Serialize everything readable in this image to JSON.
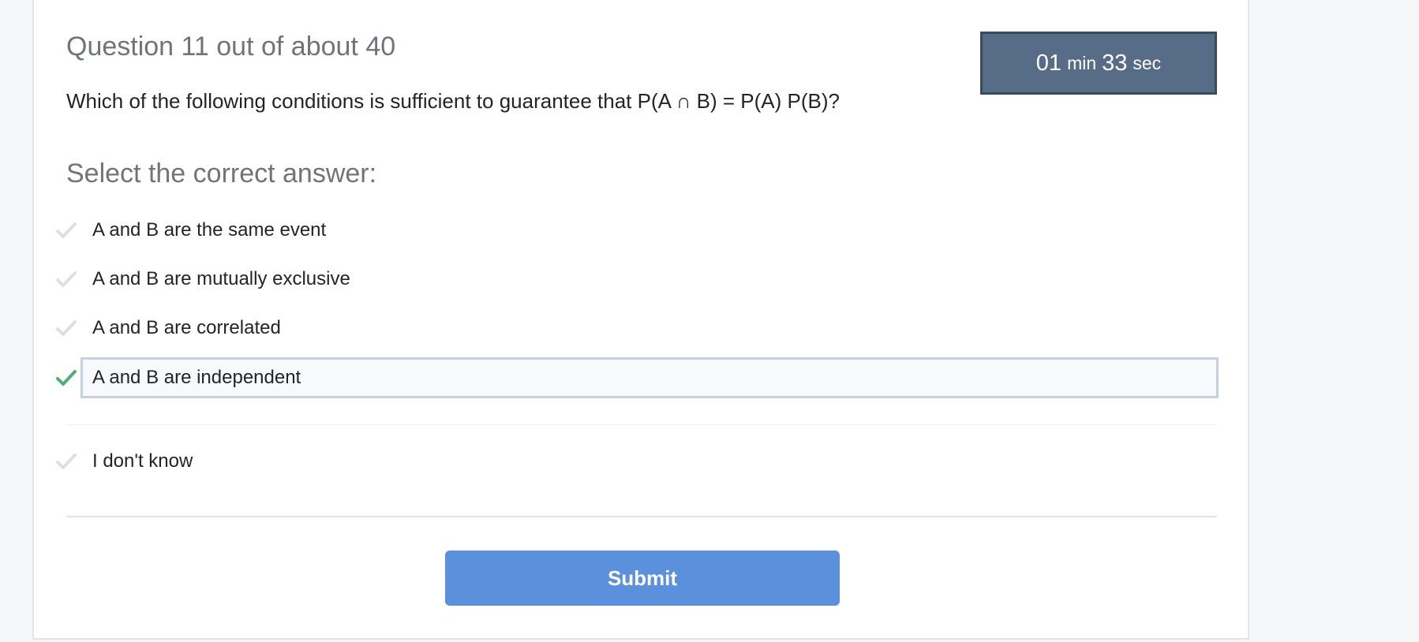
{
  "header": {
    "question_counter": "Question 11 out of about 40"
  },
  "timer": {
    "minutes": "01",
    "minutes_unit": "min",
    "seconds": "33",
    "seconds_unit": "sec"
  },
  "question": {
    "text": "Which of the following conditions is sufficient to guarantee that P(A ∩ B) = P(A) P(B)?"
  },
  "answers": {
    "prompt": "Select the correct answer:",
    "options": [
      {
        "label": "A and B are the same event",
        "selected": false
      },
      {
        "label": "A and B are mutually exclusive",
        "selected": false
      },
      {
        "label": "A and B are correlated",
        "selected": false
      },
      {
        "label": "A and B are independent",
        "selected": true
      },
      {
        "label": "I don't know",
        "selected": false
      }
    ]
  },
  "submit": {
    "label": "Submit"
  },
  "colors": {
    "check_selected": "#4caf73",
    "check_unselected": "#dcdfe3",
    "submit_bg": "#5b91dc",
    "timer_bg": "#566c87"
  },
  "icons": {
    "option_check": "check-icon"
  }
}
